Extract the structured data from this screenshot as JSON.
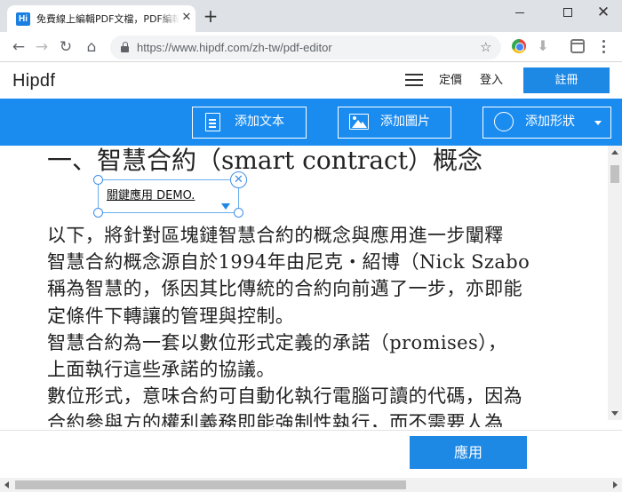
{
  "browser": {
    "tab_title": "免費線上編輯PDF文檔，PDF編輯器",
    "favicon_text": "Hi",
    "url": "https://www.hipdf.com/zh-tw/pdf-editor",
    "icons": [
      "back-arrow",
      "forward-arrow",
      "reload",
      "home",
      "lock",
      "star",
      "chrome-extension",
      "download-extension",
      "extension",
      "menu"
    ]
  },
  "site_header": {
    "logo": "Hipdf",
    "nav": {
      "pricing": "定價",
      "login": "登入",
      "register": "註冊"
    }
  },
  "toolbar": {
    "add_text": "添加文本",
    "add_image": "添加圖片",
    "add_shape": "添加形狀"
  },
  "document": {
    "heading": "一、智慧合約（smart contract）概念",
    "text_box": "關鍵應用 DEMO.",
    "lines": [
      "以下，將針對區塊鏈智慧合約的概念與應用進一步闡釋",
      "智慧合約概念源自於1994年由尼克・紹博（Nick Szabo",
      "稱為智慧的，係因其比傳統的合約向前邁了一步，亦即能",
      "定條件下轉讓的管理與控制。",
      "智慧合約為一套以數位形式定義的承諾（promises），",
      "上面執行這些承諾的協議。",
      "數位形式，意味合約可自動化執行電腦可讀的代碼，因為",
      "合約參與方的權利義務即能強制性執行，而不需要人為"
    ]
  },
  "footer": {
    "apply": "應用"
  },
  "colors": {
    "accent": "#1a8cf0",
    "button": "#1e88e5"
  }
}
